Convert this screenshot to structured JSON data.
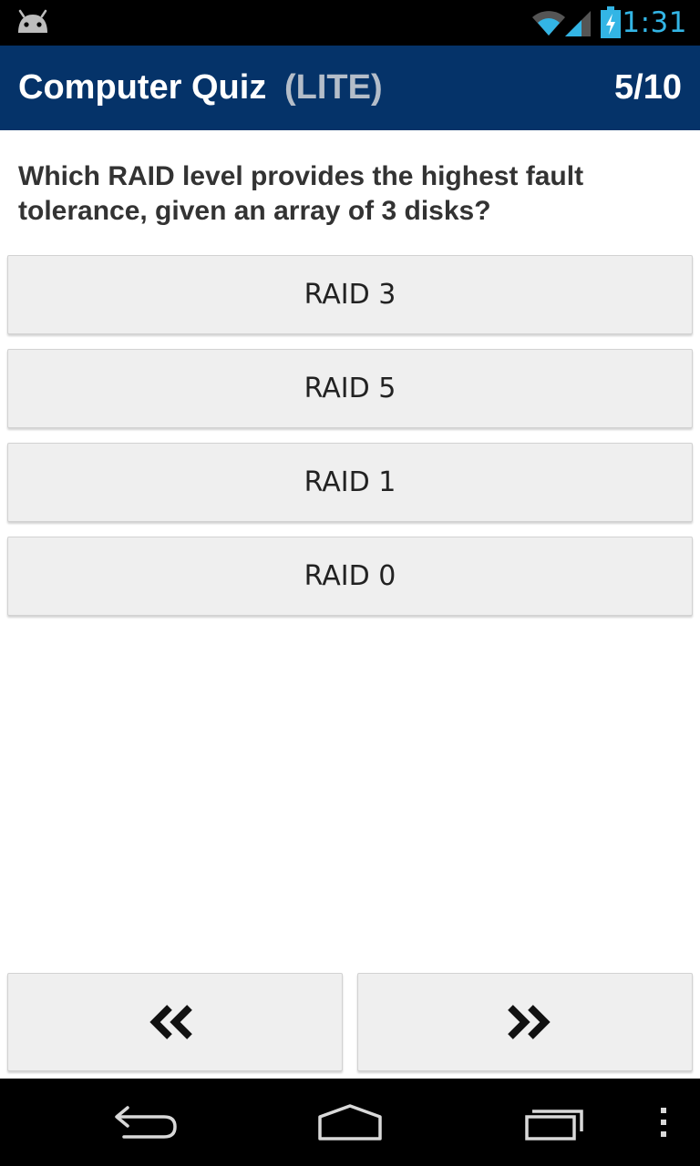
{
  "status_bar": {
    "time": "1:31",
    "icons": [
      "android-icon",
      "wifi-icon",
      "signal-icon",
      "battery-charging-icon"
    ],
    "accent_color": "#33b5e5"
  },
  "header": {
    "title": "Computer Quiz",
    "subtitle": "(LITE)",
    "progress": "5/10",
    "background_color": "#053369"
  },
  "question": {
    "text": "Which RAID level provides the highest fault tolerance, given an array of 3 disks?"
  },
  "answers": [
    {
      "label": "RAID 3"
    },
    {
      "label": "RAID 5"
    },
    {
      "label": "RAID 1"
    },
    {
      "label": "RAID 0"
    }
  ],
  "navigation": {
    "previous_icon": "double-chevron-left-icon",
    "next_icon": "double-chevron-right-icon"
  },
  "system_nav": {
    "icons": [
      "back-icon",
      "home-icon",
      "recents-icon",
      "overflow-menu-icon"
    ]
  }
}
